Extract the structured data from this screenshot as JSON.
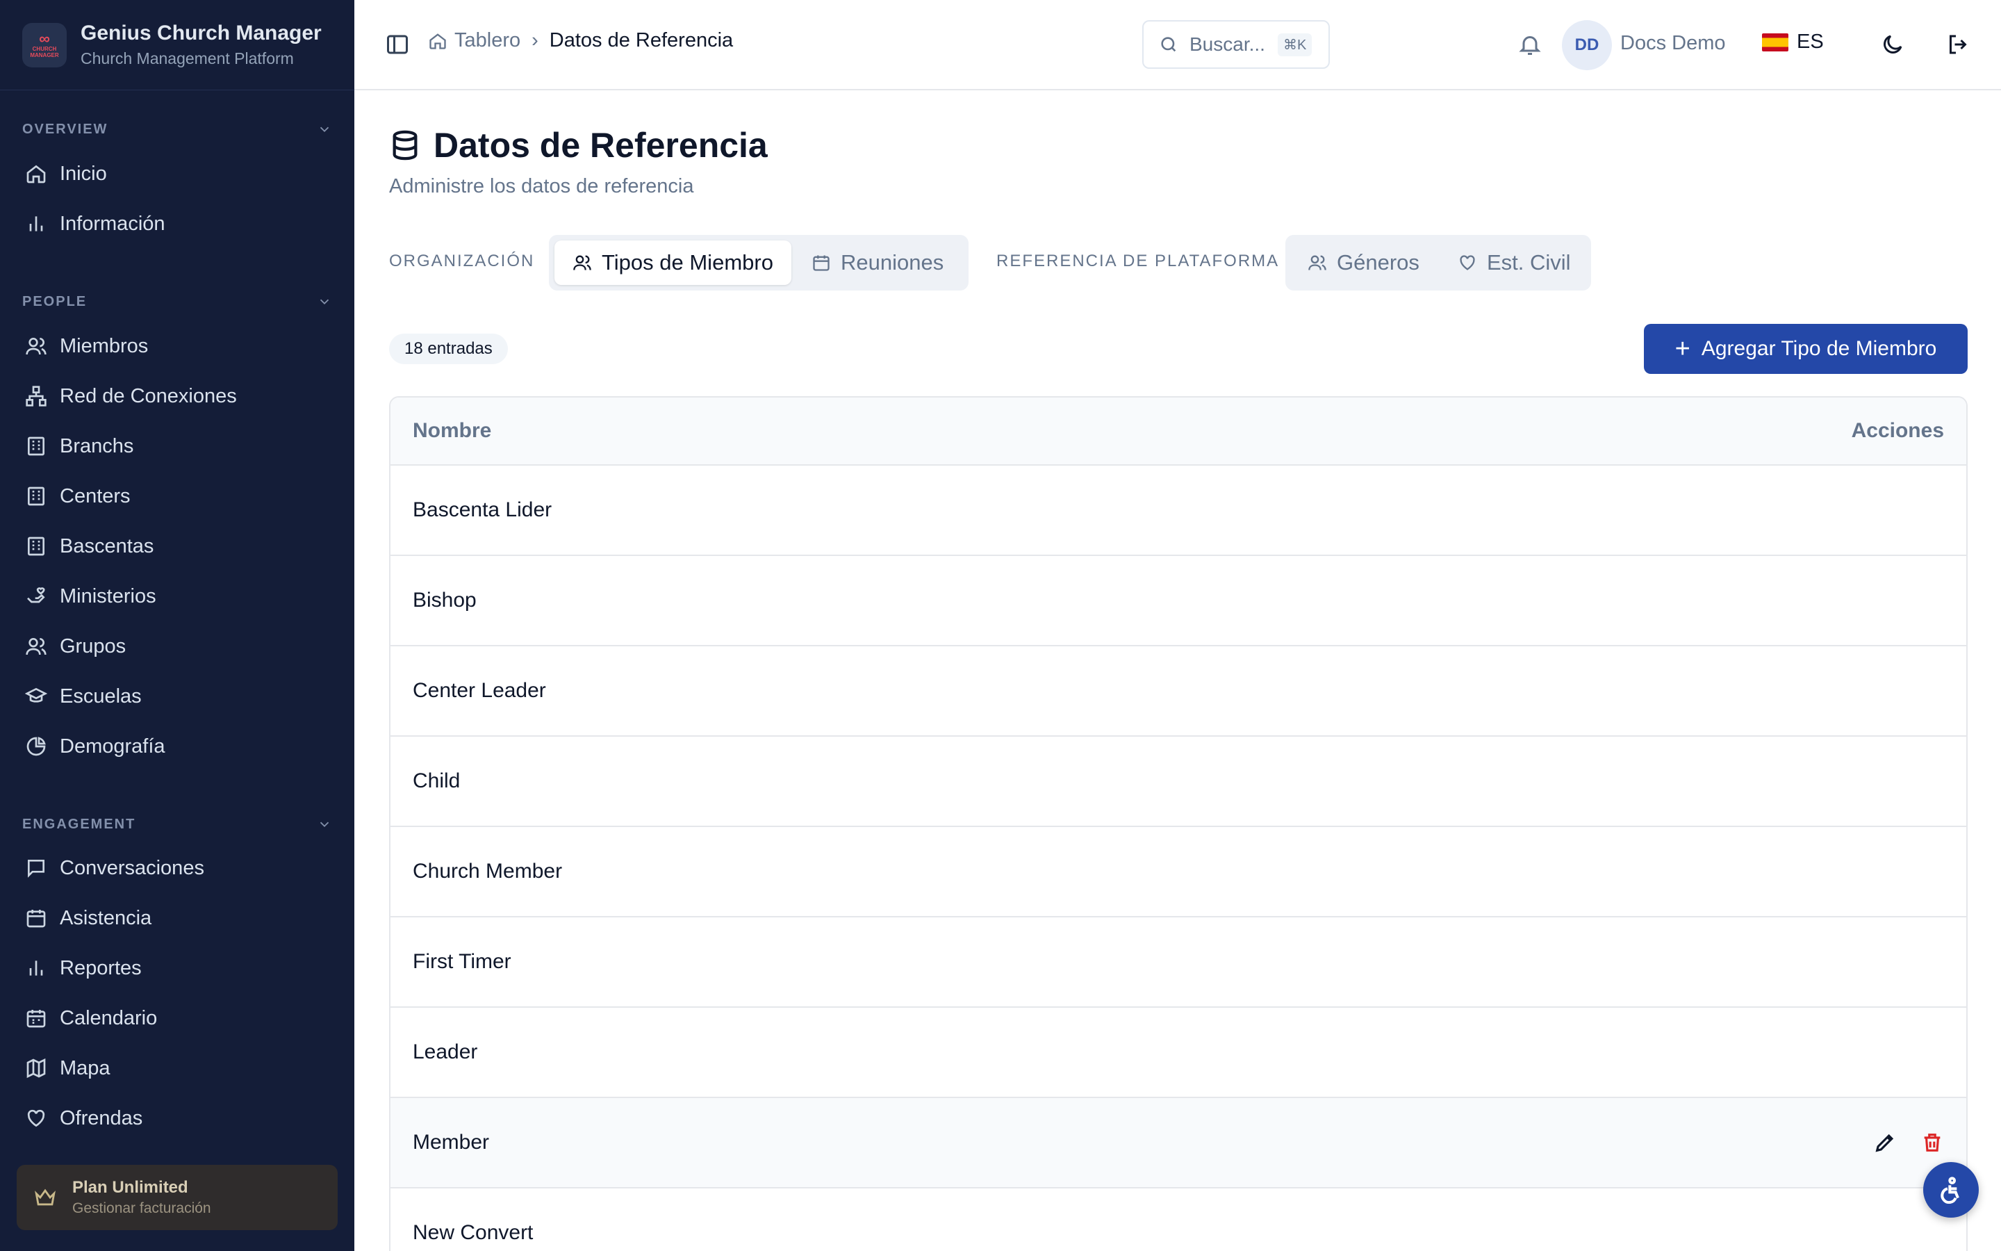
{
  "app": {
    "title": "Genius Church Manager",
    "subtitle": "Church Management Platform",
    "logo_text": "CHURCH MANAGER"
  },
  "sidebar": {
    "sections": [
      {
        "label": "OVERVIEW",
        "items": [
          {
            "label": "Inicio",
            "icon": "home-icon"
          },
          {
            "label": "Información",
            "icon": "bar-chart-icon"
          }
        ]
      },
      {
        "label": "PEOPLE",
        "items": [
          {
            "label": "Miembros",
            "icon": "users-icon"
          },
          {
            "label": "Red de Conexiones",
            "icon": "network-icon"
          },
          {
            "label": "Branchs",
            "icon": "building-icon"
          },
          {
            "label": "Centers",
            "icon": "building-icon"
          },
          {
            "label": "Bascentas",
            "icon": "building-icon"
          },
          {
            "label": "Ministerios",
            "icon": "hand-heart-icon"
          },
          {
            "label": "Grupos",
            "icon": "users-icon"
          },
          {
            "label": "Escuelas",
            "icon": "graduation-cap-icon"
          },
          {
            "label": "Demografía",
            "icon": "pie-chart-icon"
          }
        ]
      },
      {
        "label": "ENGAGEMENT",
        "items": [
          {
            "label": "Conversaciones",
            "icon": "message-icon"
          },
          {
            "label": "Asistencia",
            "icon": "calendar-icon"
          },
          {
            "label": "Reportes",
            "icon": "bar-chart-icon"
          },
          {
            "label": "Calendario",
            "icon": "calendar-icon"
          },
          {
            "label": "Mapa",
            "icon": "map-icon"
          },
          {
            "label": "Ofrendas",
            "icon": "heart-icon"
          }
        ]
      }
    ],
    "plan": {
      "title": "Plan Unlimited",
      "subtitle": "Gestionar facturación"
    }
  },
  "header": {
    "breadcrumb_home": "Tablero",
    "breadcrumb_current": "Datos de Referencia",
    "search_placeholder": "Buscar...",
    "search_shortcut": "⌘K",
    "user_initials": "DD",
    "user_name": "Docs Demo",
    "language": "ES"
  },
  "page": {
    "title": "Datos de Referencia",
    "subtitle": "Administre los datos de referencia",
    "tab_group_1_label": "ORGANIZACIÓN",
    "tab_group_1": [
      {
        "label": "Tipos de Miembro",
        "active": true
      },
      {
        "label": "Reuniones",
        "active": false
      }
    ],
    "tab_group_2_label": "REFERENCIA DE PLATAFORMA",
    "tab_group_2": [
      {
        "label": "Géneros",
        "active": false
      },
      {
        "label": "Est. Civil",
        "active": false
      }
    ],
    "entry_count": "18 entradas",
    "add_button": "Agregar Tipo de Miembro"
  },
  "table": {
    "columns": [
      "Nombre",
      "Acciones"
    ],
    "rows": [
      "Bascenta Lider",
      "Bishop",
      "Center Leader",
      "Child",
      "Church Member",
      "First Timer",
      "Leader",
      "Member",
      "New Convert"
    ],
    "hovered_row": "Member"
  },
  "colors": {
    "sidebar_bg": "#141d38",
    "primary": "#2448a8",
    "delete": "#dc2626"
  }
}
